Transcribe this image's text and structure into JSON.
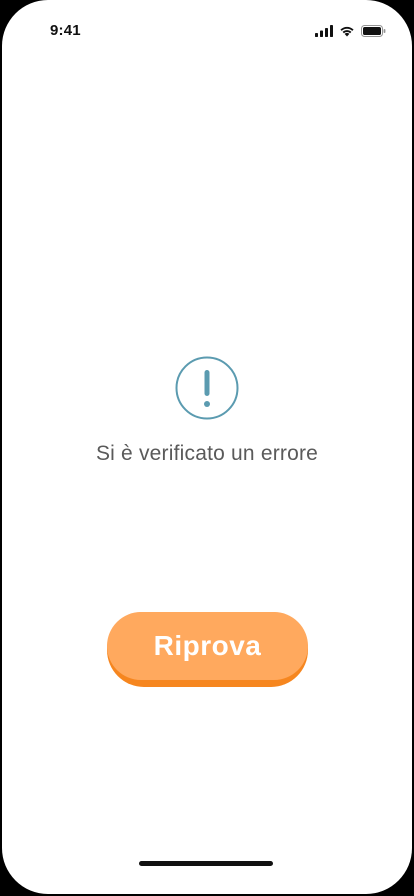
{
  "status_bar": {
    "time": "9:41",
    "icons": [
      "cellular-signal-icon",
      "wifi-icon",
      "battery-icon"
    ]
  },
  "error": {
    "icon": "exclamation-circle-icon",
    "message": "Si è verificato un errore",
    "icon_color": "#5b9bb0"
  },
  "retry_button": {
    "label": "Riprova",
    "color": "#ffa95e",
    "shadow_color": "#f6861f"
  }
}
